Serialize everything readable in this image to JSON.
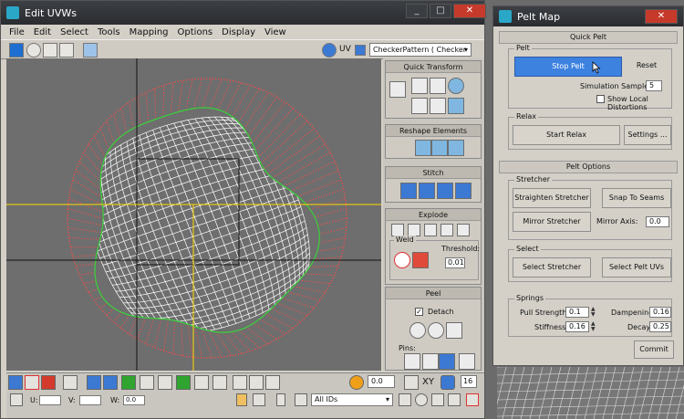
{
  "uvw_window": {
    "title": "Edit UVWs",
    "menu": [
      "File",
      "Edit",
      "Select",
      "Tools",
      "Mapping",
      "Options",
      "Display",
      "View"
    ],
    "uv_label": "UV",
    "texture_dropdown": "CheckerPattern  ( Checker )",
    "panels": {
      "quick_transform": "Quick Transform",
      "reshape_elements": "Reshape Elements",
      "stitch": "Stitch",
      "explode": "Explode",
      "weld": "Weld",
      "threshold_label": "Threshold:",
      "threshold_value": "0.01",
      "peel": "Peel",
      "detach": "Detach",
      "pins": "Pins:"
    },
    "bottom": {
      "rotation_value": "0.0",
      "xy_label": "XY",
      "count_value": "16",
      "u_label": "U:",
      "v_label": "V:",
      "w_label": "W:",
      "w_value": "0.0",
      "ids_dropdown": "All IDs"
    }
  },
  "pelt_window": {
    "title": "Pelt Map",
    "quick_pelt": "Quick Pelt",
    "pelt_group": "Pelt",
    "stop_pelt": "Stop Pelt",
    "reset": "Reset",
    "simulation_samples_label": "Simulation Samples:",
    "simulation_samples_value": "5",
    "show_local_distortions": "Show Local Distortions",
    "relax_group": "Relax",
    "start_relax": "Start Relax",
    "settings": "Settings ...",
    "pelt_options": "Pelt Options",
    "stretcher_group": "Stretcher",
    "straighten_stretcher": "Straighten Stretcher",
    "snap_to_seams": "Snap To Seams",
    "mirror_stretcher": "Mirror Stretcher",
    "mirror_axis_label": "Mirror Axis:",
    "mirror_axis_value": "0.0",
    "select_group": "Select",
    "select_stretcher": "Select Stretcher",
    "select_pelt_uvs": "Select Pelt UVs",
    "springs_group": "Springs",
    "pull_strength_label": "Pull Strength:",
    "pull_strength_value": "0.1",
    "dampening_label": "Dampening:",
    "dampening_value": "0.16",
    "stiffness_label": "Stiffness:",
    "stiffness_value": "0.16",
    "decay_label": "Decay:",
    "decay_value": "0.25",
    "commit": "Commit"
  },
  "colors": {
    "pelt_active": "#3e82e0",
    "stretcher_points": "#ff4a4a",
    "seam_line": "#38d23a",
    "mesh_lines": "#ffffff",
    "uv_axis": "#ffd800",
    "close_button": "#c63a2b"
  }
}
